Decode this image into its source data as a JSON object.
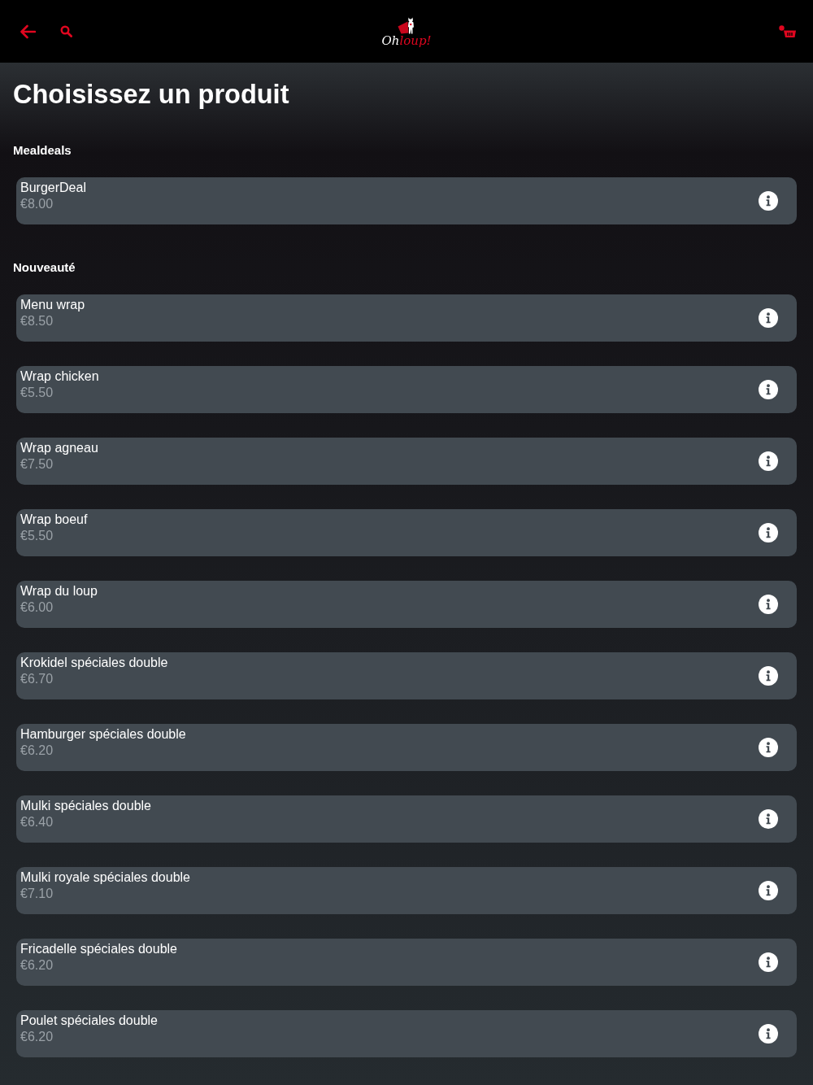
{
  "header": {
    "logo": {
      "text_start": "Oh",
      "text_end": "loup!"
    }
  },
  "title": "Choisissez un produit",
  "sections": [
    {
      "heading": "Mealdeals",
      "products": [
        {
          "name": "BurgerDeal",
          "price": "€8.00"
        }
      ]
    },
    {
      "heading": "Nouveauté",
      "products": [
        {
          "name": "Menu wrap",
          "price": "€8.50"
        },
        {
          "name": "Wrap chicken",
          "price": "€5.50"
        },
        {
          "name": "Wrap agneau",
          "price": "€7.50"
        },
        {
          "name": "Wrap boeuf",
          "price": "€5.50"
        },
        {
          "name": "Wrap du loup",
          "price": "€6.00"
        },
        {
          "name": "Krokidel spéciales double",
          "price": "€6.70"
        },
        {
          "name": "Hamburger spéciales double",
          "price": "€6.20"
        },
        {
          "name": "Mulki spéciales double",
          "price": "€6.40"
        },
        {
          "name": "Mulki royale spéciales double",
          "price": "€7.10"
        },
        {
          "name": "Fricadelle spéciales double",
          "price": "€6.20"
        },
        {
          "name": "Poulet spéciales double",
          "price": "€6.20"
        }
      ]
    }
  ]
}
